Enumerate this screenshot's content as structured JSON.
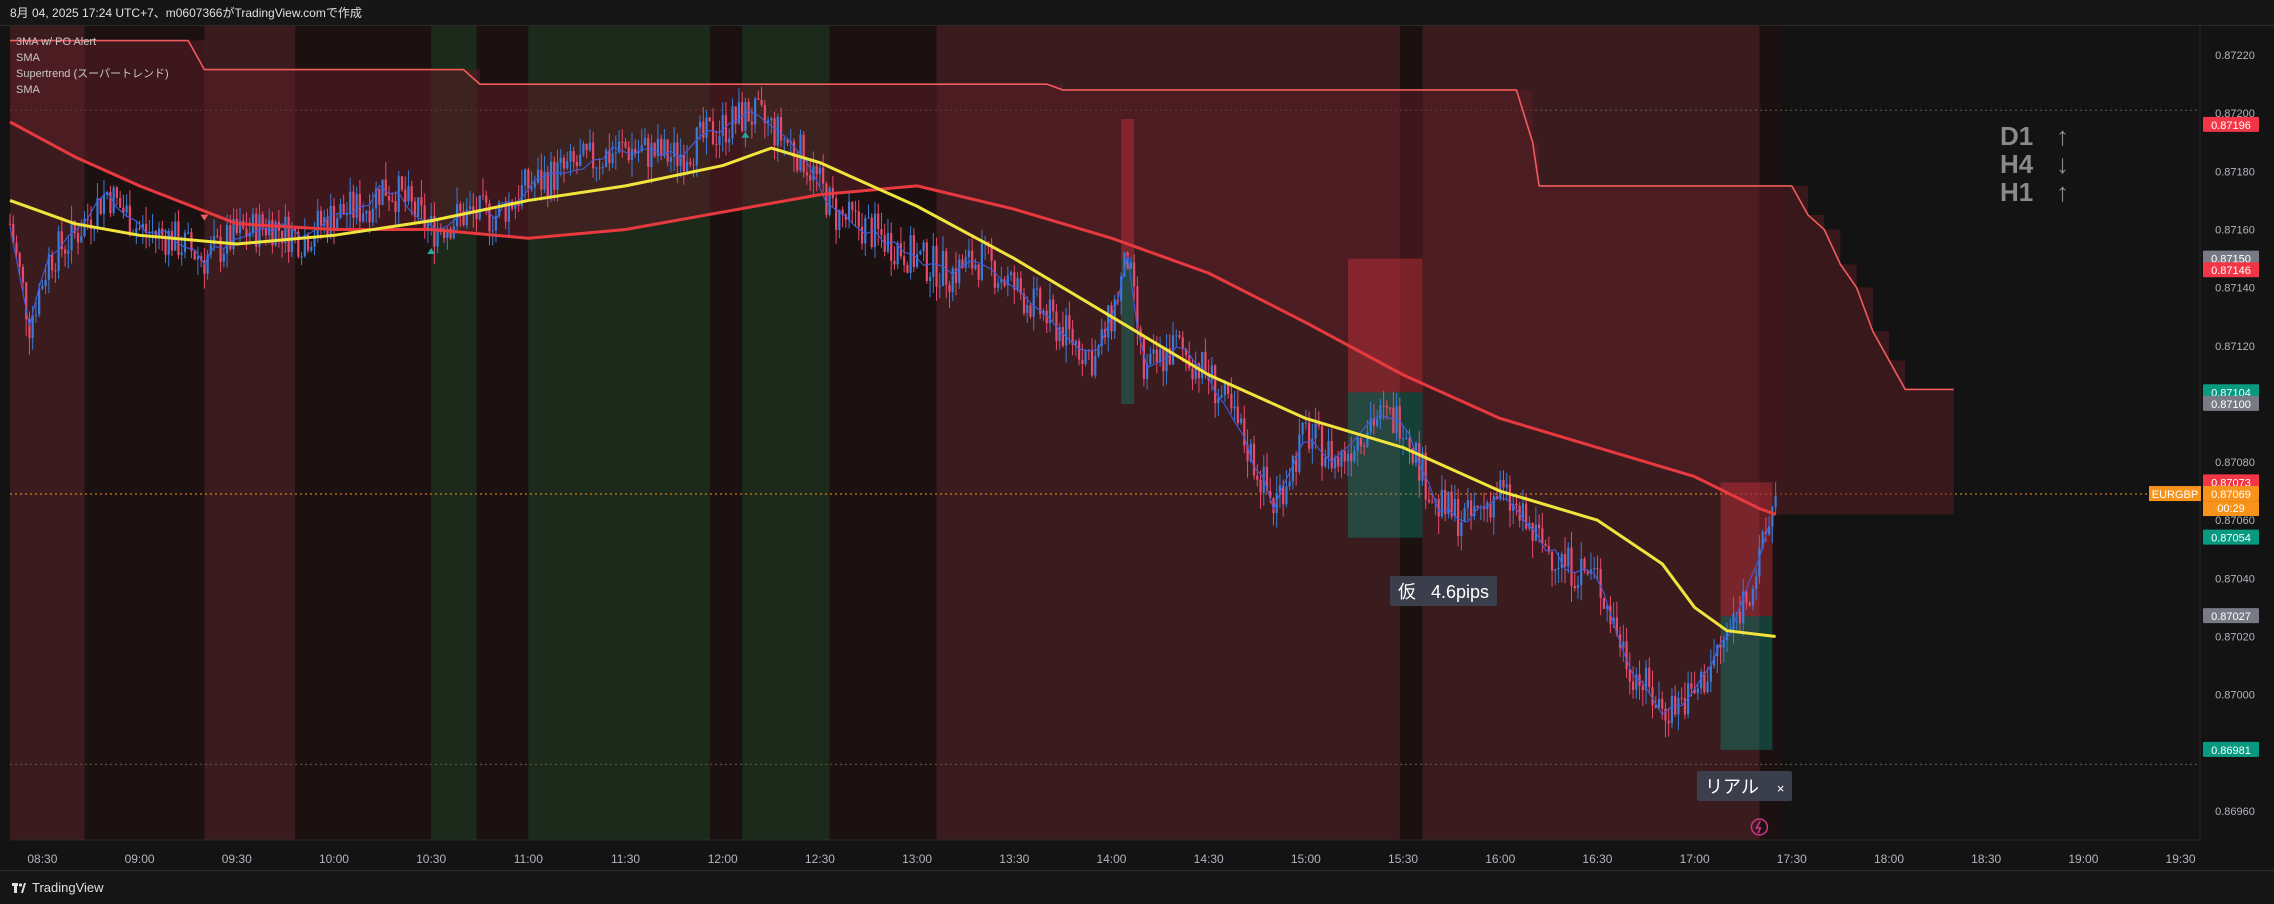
{
  "header": {
    "text": "8月 04, 2025 17:24 UTC+7、m0607366がTradingView.comで作成"
  },
  "legend": {
    "items": [
      "3MA w/ PO Alert",
      "SMA",
      "Supertrend (スーパートレンド)",
      "SMA"
    ]
  },
  "timeframes": [
    {
      "label": "D1",
      "arrow": "↑"
    },
    {
      "label": "H4",
      "arrow": "↓"
    },
    {
      "label": "H1",
      "arrow": "↑"
    }
  ],
  "annotations": {
    "kari": "仮   4.6pips",
    "real": "リアル",
    "close": "×"
  },
  "footer": {
    "brand": "TradingView"
  },
  "colors": {
    "background": "#131313",
    "bull": "#3a7bd5",
    "bear": "#e84a6c",
    "supertrend": "#f15b5b",
    "sma_slow": "#e8393f",
    "sma_fast": "#f1e43c",
    "ma_thin": "#3f5ddf"
  },
  "chart_data": {
    "type": "candlestick",
    "symbol": "EURGBP",
    "ylim": [
      0.8695,
      0.8723
    ],
    "y_ticks": [
      "0.87220",
      "0.87200",
      "0.87180",
      "0.87160",
      "0.87140",
      "0.87120",
      "0.87100",
      "0.87080",
      "0.87060",
      "0.87040",
      "0.87020",
      "0.87000",
      "0.86980",
      "0.86960"
    ],
    "x_ticks": [
      "08:30",
      "09:00",
      "09:30",
      "10:00",
      "10:30",
      "11:00",
      "11:30",
      "12:00",
      "12:30",
      "13:00",
      "13:30",
      "14:00",
      "14:30",
      "15:00",
      "15:30",
      "16:00",
      "16:30",
      "17:00",
      "17:30",
      "18:00",
      "18:30",
      "19:00",
      "19:30"
    ],
    "price_labels": [
      {
        "value": 0.87196,
        "text": "0.87196",
        "color": "#f23645"
      },
      {
        "value": 0.8715,
        "text": "0.87150",
        "color": "#787b86"
      },
      {
        "value": 0.87146,
        "text": "0.87146",
        "color": "#f23645"
      },
      {
        "value": 0.87104,
        "text": "0.87104",
        "color": "#089981"
      },
      {
        "value": 0.871,
        "text": "0.87100",
        "color": "#787b86"
      },
      {
        "value": 0.87073,
        "text": "0.87073",
        "color": "#f23645"
      },
      {
        "value": 0.87069,
        "text": "0.87069",
        "color": "#f7931a"
      },
      {
        "value": 0.87054,
        "text": "0.87054",
        "color": "#089981"
      },
      {
        "value": 0.87027,
        "text": "0.87027",
        "color": "#787b86"
      },
      {
        "value": 0.86981,
        "text": "0.86981",
        "color": "#089981"
      }
    ],
    "current": {
      "symbol_tag": "EURGBP",
      "price": "0.87069",
      "countdown": "00:29"
    },
    "close_path": [
      [
        "08:20",
        0.87162
      ],
      [
        "08:26",
        0.87128
      ],
      [
        "08:32",
        0.8715
      ],
      [
        "08:40",
        0.87158
      ],
      [
        "08:50",
        0.87173
      ],
      [
        "09:00",
        0.8716
      ],
      [
        "09:10",
        0.87157
      ],
      [
        "09:20",
        0.8715
      ],
      [
        "09:30",
        0.87158
      ],
      [
        "09:40",
        0.87162
      ],
      [
        "09:50",
        0.87157
      ],
      [
        "10:00",
        0.87165
      ],
      [
        "10:10",
        0.87168
      ],
      [
        "10:15",
        0.87175
      ],
      [
        "10:20",
        0.87172
      ],
      [
        "10:30",
        0.8716
      ],
      [
        "10:40",
        0.87165
      ],
      [
        "10:50",
        0.87165
      ],
      [
        "11:00",
        0.87175
      ],
      [
        "11:15",
        0.87182
      ],
      [
        "11:30",
        0.87188
      ],
      [
        "11:45",
        0.87185
      ],
      [
        "12:00",
        0.87195
      ],
      [
        "12:08",
        0.872
      ],
      [
        "12:15",
        0.87195
      ],
      [
        "12:25",
        0.87185
      ],
      [
        "12:35",
        0.87165
      ],
      [
        "12:45",
        0.8716
      ],
      [
        "13:00",
        0.8715
      ],
      [
        "13:10",
        0.87145
      ],
      [
        "13:20",
        0.8715
      ],
      [
        "13:30",
        0.8714
      ],
      [
        "13:40",
        0.8713
      ],
      [
        "13:55",
        0.87115
      ],
      [
        "14:00",
        0.8713
      ],
      [
        "14:05",
        0.8715
      ],
      [
        "14:10",
        0.8711
      ],
      [
        "14:20",
        0.8712
      ],
      [
        "14:30",
        0.8711
      ],
      [
        "14:40",
        0.8709
      ],
      [
        "14:50",
        0.87065
      ],
      [
        "15:00",
        0.8709
      ],
      [
        "15:10",
        0.8708
      ],
      [
        "15:20",
        0.87095
      ],
      [
        "15:30",
        0.87095
      ],
      [
        "15:40",
        0.87065
      ],
      [
        "15:50",
        0.8706
      ],
      [
        "16:00",
        0.8707
      ],
      [
        "16:10",
        0.87055
      ],
      [
        "16:20",
        0.87045
      ],
      [
        "16:30",
        0.8704
      ],
      [
        "16:40",
        0.8701
      ],
      [
        "16:50",
        0.86995
      ],
      [
        "17:00",
        0.87
      ],
      [
        "17:10",
        0.8702
      ],
      [
        "17:20",
        0.87045
      ],
      [
        "17:25",
        0.87069
      ]
    ],
    "supertrend": [
      [
        "08:20",
        0.87225
      ],
      [
        "09:15",
        0.87225
      ],
      [
        "09:20",
        0.87215
      ],
      [
        "10:40",
        0.87215
      ],
      [
        "10:45",
        0.8721
      ],
      [
        "13:40",
        0.8721
      ],
      [
        "13:45",
        0.87208
      ],
      [
        "16:05",
        0.87208
      ],
      [
        "16:10",
        0.8719
      ],
      [
        "16:12",
        0.87175
      ],
      [
        "17:30",
        0.87175
      ],
      [
        "17:35",
        0.87165
      ],
      [
        "17:40",
        0.8716
      ],
      [
        "17:45",
        0.87148
      ],
      [
        "17:50",
        0.8714
      ],
      [
        "17:55",
        0.87125
      ],
      [
        "18:00",
        0.87115
      ],
      [
        "18:05",
        0.87105
      ],
      [
        "18:20",
        0.87105
      ]
    ],
    "sma_slow": [
      [
        "08:20",
        0.87197
      ],
      [
        "08:40",
        0.87185
      ],
      [
        "09:00",
        0.87175
      ],
      [
        "09:30",
        0.87162
      ],
      [
        "10:00",
        0.8716
      ],
      [
        "10:30",
        0.8716
      ],
      [
        "11:00",
        0.87157
      ],
      [
        "11:30",
        0.8716
      ],
      [
        "12:00",
        0.87166
      ],
      [
        "12:30",
        0.87172
      ],
      [
        "13:00",
        0.87175
      ],
      [
        "13:30",
        0.87167
      ],
      [
        "14:00",
        0.87157
      ],
      [
        "14:30",
        0.87145
      ],
      [
        "15:00",
        0.87128
      ],
      [
        "15:30",
        0.8711
      ],
      [
        "16:00",
        0.87095
      ],
      [
        "16:30",
        0.87085
      ],
      [
        "17:00",
        0.87075
      ],
      [
        "17:20",
        0.87064
      ],
      [
        "17:25",
        0.87062
      ]
    ],
    "sma_fast": [
      [
        "08:20",
        0.8717
      ],
      [
        "08:40",
        0.87162
      ],
      [
        "09:00",
        0.87158
      ],
      [
        "09:30",
        0.87155
      ],
      [
        "10:00",
        0.87158
      ],
      [
        "10:30",
        0.87163
      ],
      [
        "11:00",
        0.8717
      ],
      [
        "11:30",
        0.87175
      ],
      [
        "12:00",
        0.87182
      ],
      [
        "12:15",
        0.87188
      ],
      [
        "12:30",
        0.87183
      ],
      [
        "13:00",
        0.87168
      ],
      [
        "13:30",
        0.8715
      ],
      [
        "14:00",
        0.8713
      ],
      [
        "14:30",
        0.8711
      ],
      [
        "15:00",
        0.87095
      ],
      [
        "15:30",
        0.87085
      ],
      [
        "16:00",
        0.8707
      ],
      [
        "16:30",
        0.8706
      ],
      [
        "16:50",
        0.87045
      ],
      [
        "17:00",
        0.8703
      ],
      [
        "17:10",
        0.87022
      ],
      [
        "17:25",
        0.8702
      ]
    ],
    "shaded_zones": [
      {
        "from": "08:20",
        "to": "08:43",
        "kind": "bear"
      },
      {
        "from": "09:20",
        "to": "09:48",
        "kind": "bear"
      },
      {
        "from": "10:30",
        "to": "10:44",
        "kind": "bull"
      },
      {
        "from": "11:00",
        "to": "11:56",
        "kind": "bull"
      },
      {
        "from": "12:06",
        "to": "12:33",
        "kind": "bull"
      },
      {
        "from": "13:06",
        "to": "15:29",
        "kind": "bear"
      },
      {
        "from": "15:36",
        "to": "17:20",
        "kind": "bear"
      }
    ],
    "position_boxes": [
      {
        "from": "14:03",
        "to": "14:07",
        "entry": 0.8715,
        "target": 0.871,
        "stop": 0.87198,
        "kind": "short"
      },
      {
        "from": "15:13",
        "to": "15:36",
        "entry": 0.87104,
        "target": 0.87054,
        "stop": 0.8715,
        "kind": "short"
      },
      {
        "from": "17:08",
        "to": "17:24",
        "entry": 0.87027,
        "target": 0.86981,
        "stop": 0.87073,
        "kind": "long"
      }
    ],
    "markers": [
      {
        "time": "09:20",
        "price": 0.87162,
        "kind": "down"
      },
      {
        "time": "10:30",
        "price": 0.87155,
        "kind": "up"
      },
      {
        "time": "12:07",
        "price": 0.87195,
        "kind": "up"
      }
    ]
  }
}
